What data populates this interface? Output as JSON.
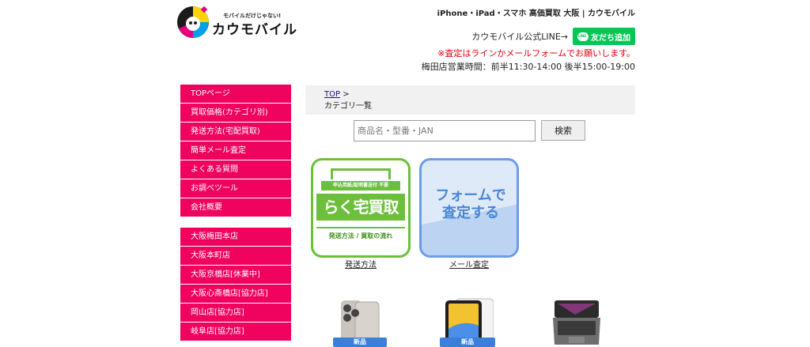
{
  "logo": {
    "tagline": "モバイルだけじゃない!",
    "name": "カウモバイル"
  },
  "header": {
    "site_title": "iPhone・iPad・スマホ 高価買取 大阪 | カウモバイル",
    "line_label": "カウモバイル公式LINE→",
    "line_button": "友だち追加",
    "notice": "※査定はラインかメールフォームでお願いします。",
    "hours": "梅田店営業時間：前半11:30-14:00 後半15:00-19:00"
  },
  "sidebar": {
    "menu": [
      "TOPページ",
      "買取価格(カテゴリ別)",
      "発送方法(宅配買取)",
      "簡単メール査定",
      "よくある質問",
      "お調べツール",
      "会社概要"
    ],
    "stores": [
      "大阪梅田本店",
      "大阪本町店",
      "大阪京橋店[休業中]",
      "大阪心斎橋店[協力店]",
      "岡山店[協力店]",
      "岐阜店[協力店]"
    ]
  },
  "breadcrumb": {
    "top": "TOP",
    "separator": ">",
    "current": "カテゴリ一覧"
  },
  "search": {
    "placeholder": "商品名・型番・JAN",
    "button": "検索"
  },
  "banners": {
    "raku": {
      "top": "申込用紙/証明書送付 不要",
      "main": "らく宅買取",
      "bottom": "発送方法 / 買取の流れ",
      "caption": "発送方法"
    },
    "form": {
      "line1": "フォームで",
      "line2": "査定する",
      "caption": "メール査定"
    }
  },
  "products": {
    "badge": "新品"
  },
  "colors": {
    "sidebar": "#f0035e",
    "line_green": "#06c755",
    "notice_red": "#e60012",
    "raku_green": "#6cbf3a",
    "form_blue": "#6b9ce8"
  }
}
